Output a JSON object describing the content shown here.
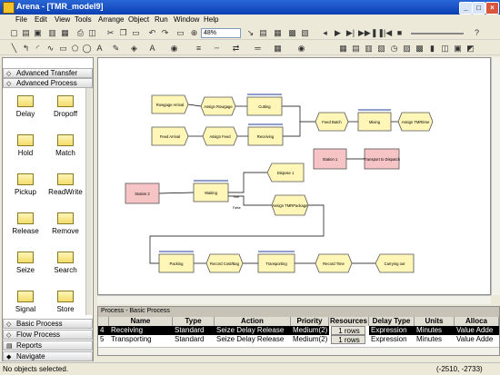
{
  "window": {
    "title": "Arena - [TMR_model9]"
  },
  "menu": [
    "File",
    "Edit",
    "View",
    "Tools",
    "Arrange",
    "Object",
    "Run",
    "Window",
    "Help"
  ],
  "toolbar": {
    "zoom": "48%"
  },
  "panel": {
    "top_bars": [
      "Advanced Transfer",
      "Advanced Process"
    ],
    "modules": [
      [
        "Delay",
        "Dropoff"
      ],
      [
        "Hold",
        "Match"
      ],
      [
        "Pickup",
        "ReadWrite"
      ],
      [
        "Release",
        "Remove"
      ],
      [
        "Seize",
        "Search"
      ],
      [
        "Signal",
        "Store"
      ]
    ],
    "bottom_bars": [
      "Basic Process",
      "Flow Process",
      "Reports",
      "Navigate"
    ]
  },
  "flow": {
    "modules": [
      {
        "id": "ra",
        "label": "Rowgage Arrival",
        "type": "create"
      },
      {
        "id": "ar",
        "label": "Assign Rowgage",
        "type": "assign"
      },
      {
        "id": "cu",
        "label": "Cutting",
        "type": "process"
      },
      {
        "id": "fa",
        "label": "Feed Arrival",
        "type": "create"
      },
      {
        "id": "af",
        "label": "Assign Feed",
        "type": "assign"
      },
      {
        "id": "rc",
        "label": "Receiving",
        "type": "process"
      },
      {
        "id": "fb",
        "label": "Feed Batch",
        "type": "batch"
      },
      {
        "id": "mx",
        "label": "Mixing",
        "type": "process"
      },
      {
        "id": "at",
        "label": "Assign TMRtime",
        "type": "assign"
      },
      {
        "id": "s1",
        "label": "Station 1",
        "type": "station"
      },
      {
        "id": "tr",
        "label": "Transport to Dispatch",
        "type": "station"
      },
      {
        "id": "s2",
        "label": "Station 2",
        "type": "station"
      },
      {
        "id": "wt",
        "label": "Waiting",
        "type": "process"
      },
      {
        "id": "dp",
        "label": "Dispose 1",
        "type": "dispose"
      },
      {
        "id": "am",
        "label": "Assign TMRPackage",
        "type": "assign"
      },
      {
        "id": "pk",
        "label": "Packing",
        "type": "process"
      },
      {
        "id": "rcb",
        "label": "Record Cost/Bag",
        "type": "record"
      },
      {
        "id": "tp",
        "label": "Transporting",
        "type": "process"
      },
      {
        "id": "rt",
        "label": "Record Time",
        "type": "record"
      },
      {
        "id": "co",
        "label": "Carrying out",
        "type": "dispose"
      }
    ],
    "branch_labels": [
      "True",
      "False"
    ]
  },
  "spreadsheet": {
    "title": "Process - Basic Process",
    "columns": [
      "",
      "Name",
      "Type",
      "Action",
      "Priority",
      "Resources",
      "Delay Type",
      "Units",
      "Alloca"
    ],
    "rows": [
      [
        "4",
        "Receiving",
        "Standard",
        "Seize Delay Release",
        "Medium(2)",
        "1 rows",
        "Expression",
        "Minutes",
        "Value Adde"
      ],
      [
        "5",
        "Transporting",
        "Standard",
        "Seize Delay Release",
        "Medium(2)",
        "1 rows",
        "Expression",
        "Minutes",
        "Value Adde"
      ]
    ]
  },
  "status": {
    "left": "No objects selected.",
    "coords": "(-2510, -2733)"
  }
}
